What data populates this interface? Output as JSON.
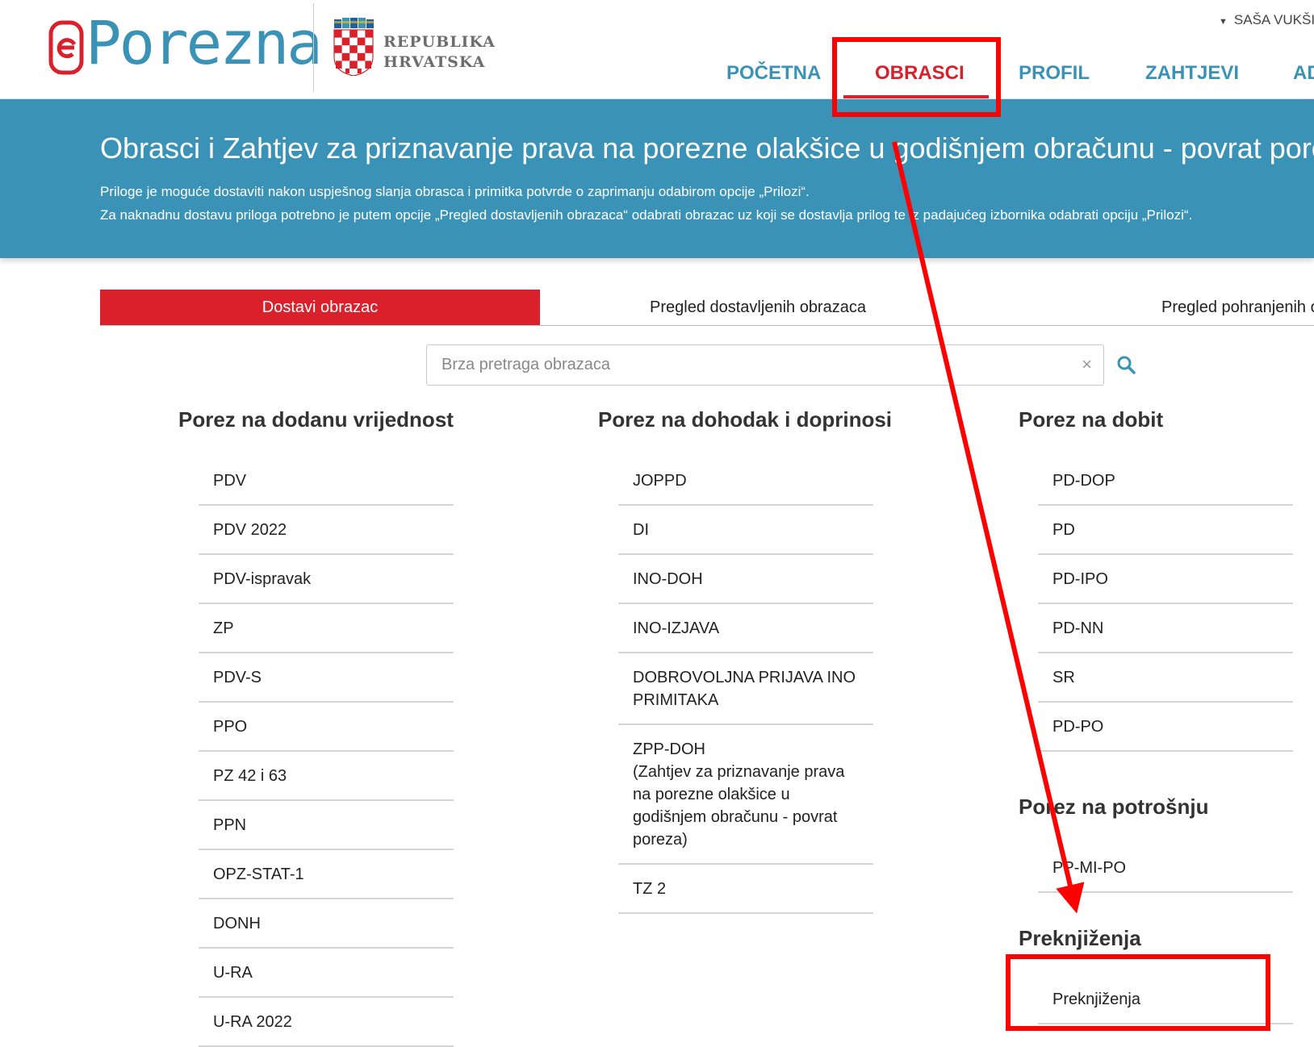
{
  "header": {
    "logo_text": "Porezna",
    "republic_line1": "REPUBLIKA",
    "republic_line2": "HRVATSKA",
    "user_name": "SAŠA VUKŠI",
    "nav": [
      {
        "label": "POČETNA"
      },
      {
        "label": "OBRASCI",
        "active": true
      },
      {
        "label": "PROFIL"
      },
      {
        "label": "ZAHTJEVI"
      },
      {
        "label": "AD"
      }
    ]
  },
  "banner": {
    "title": "Obrasci i Zahtjev za priznavanje prava na porezne olakšice u godišnjem obračunu - povrat poreza",
    "line1": "Priloge je moguće dostaviti nakon uspješnog slanja obrasca i primitka potvrde o zaprimanju odabirom opcije „Prilozi“.",
    "line2": "Za naknadnu dostavu priloga potrebno je putem opcije „Pregled dostavljenih obrazaca“ odabrati obrazac uz koji se dostavlja prilog te iz padajućeg izbornika odabrati opciju „Prilozi“."
  },
  "tabs": [
    {
      "label": "Dostavi obrazac",
      "active": true
    },
    {
      "label": "Pregled dostavljenih obrazaca"
    },
    {
      "label": "Pregled pohranjenih obr"
    }
  ],
  "search": {
    "placeholder": "Brza pretraga obrazaca",
    "value": "",
    "clear_symbol": "×"
  },
  "columns": {
    "pdv": {
      "title": "Porez na dodanu vrijednost",
      "items": [
        "PDV",
        "PDV 2022",
        "PDV-ispravak",
        "ZP",
        "PDV-S",
        "PPO",
        "PZ 42 i 63",
        "PPN",
        "OPZ-STAT-1",
        "DONH",
        "U-RA",
        "U-RA 2022"
      ]
    },
    "dohodak": {
      "title": "Porez na dohodak i doprinosi",
      "items": [
        "JOPPD",
        "DI",
        "INO-DOH",
        "INO-IZJAVA",
        "DOBROVOLJNA PRIJAVA INO PRIMITAKA",
        "ZPP-DOH\n(Zahtjev za priznavanje prava na porezne olakšice u godišnjem obračunu - povrat poreza)",
        "TZ 2"
      ]
    },
    "dobit": {
      "title": "Porez na dobit",
      "items": [
        "PD-DOP",
        "PD",
        "PD-IPO",
        "PD-NN",
        "SR",
        "PD-PO"
      ]
    },
    "potrosnja": {
      "title": "Porez na potrošnju",
      "items": [
        "PP-MI-PO"
      ]
    },
    "preknjizenja": {
      "title": "Preknjiženja",
      "items": [
        "Preknjiženja"
      ]
    }
  },
  "colors": {
    "brand_blue": "#3a93b6",
    "brand_red": "#d9202b",
    "annotation_red": "#ff0000"
  },
  "icons": {
    "search": "search-icon",
    "clear": "close-icon",
    "user_caret": "caret-down-icon"
  }
}
